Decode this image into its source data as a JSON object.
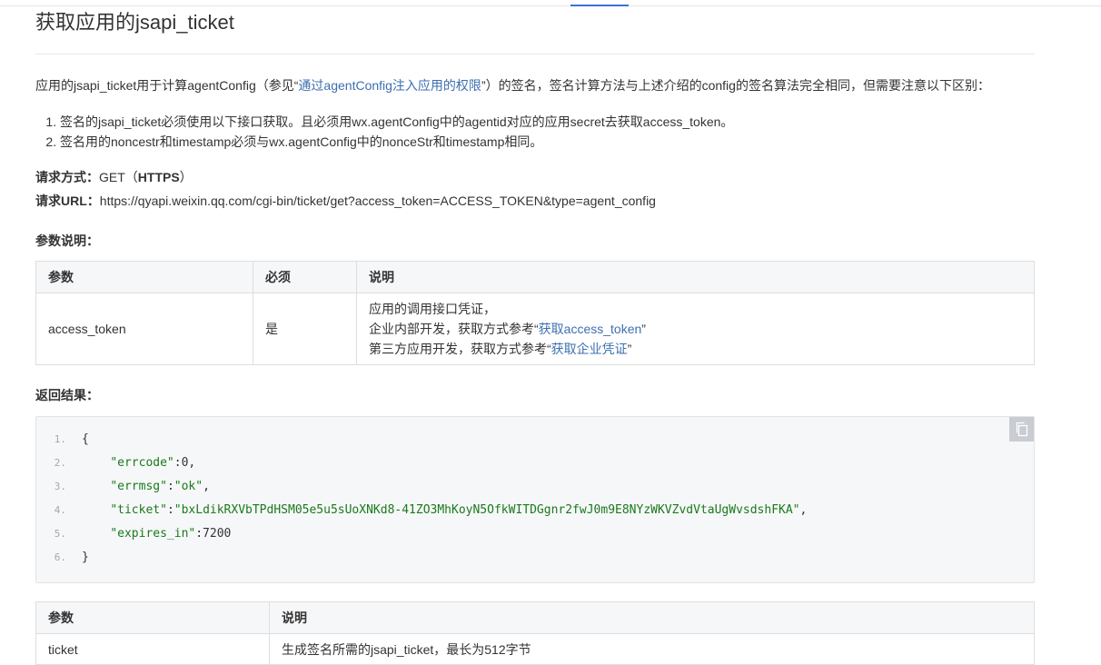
{
  "page": {
    "title": "获取应用的jsapi_ticket"
  },
  "intro": {
    "before_link": "应用的jsapi_ticket用于计算agentConfig（参见“",
    "link_text": "通过agentConfig注入应用的权限",
    "after_link": "”）的签名，签名计算方法与上述介绍的config的签名算法完全相同，但需要注意以下区别："
  },
  "rules": [
    "签名的jsapi_ticket必须使用以下接口获取。且必须用wx.agentConfig中的agentid对应的应用secret去获取access_token。",
    "签名用的noncestr和timestamp必须与wx.agentConfig中的nonceStr和timestamp相同。"
  ],
  "request": {
    "method_label": "请求方式：",
    "method_value": "GET（",
    "method_protocol": "HTTPS",
    "method_close": "）",
    "url_label": "请求URL：",
    "url_value": "https://qyapi.weixin.qq.com/cgi-bin/ticket/get?access_token=ACCESS_TOKEN&type=agent_config"
  },
  "params_section": {
    "heading": "参数说明：",
    "headers": [
      "参数",
      "必须",
      "说明"
    ],
    "row": {
      "param": "access_token",
      "required": "是",
      "desc_line1": "应用的调用接口凭证，",
      "desc_line2_prefix": "企业内部开发，获取方式参考“",
      "desc_line2_link": "获取access_token",
      "desc_line2_suffix": "”",
      "desc_line3_prefix": "第三方应用开发，获取方式参考“",
      "desc_line3_link": "获取企业凭证",
      "desc_line3_suffix": "”"
    }
  },
  "result_section": {
    "heading": "返回结果：",
    "line_numbers": [
      "1.",
      "2.",
      "3.",
      "4.",
      "5.",
      "6."
    ],
    "code": {
      "open_brace": "{",
      "errcode_key": "\"errcode\"",
      "errcode_val": ":0,",
      "errmsg_key": "\"errmsg\"",
      "errmsg_colon": ":",
      "errmsg_val": "\"ok\"",
      "errmsg_comma": ",",
      "ticket_key": "\"ticket\"",
      "ticket_colon": ":",
      "ticket_val": "\"bxLdikRXVbTPdHSM05e5u5sUoXNKd8-41ZO3MhKoyN5OfkWITDGgnr2fwJ0m9E8NYzWKVZvdVtaUgWvsdshFKA\"",
      "ticket_comma": ",",
      "expires_key": "\"expires_in\"",
      "expires_val": ":7200",
      "close_brace": "}"
    }
  },
  "return_params": {
    "headers": [
      "参数",
      "说明"
    ],
    "row_param": "ticket",
    "row_desc": "生成签名所需的jsapi_ticket，最长为512字节"
  },
  "colors": {
    "link": "#3d6fb0",
    "tab_indicator": "#3d72d9",
    "code_string": "#1a7a1a"
  }
}
